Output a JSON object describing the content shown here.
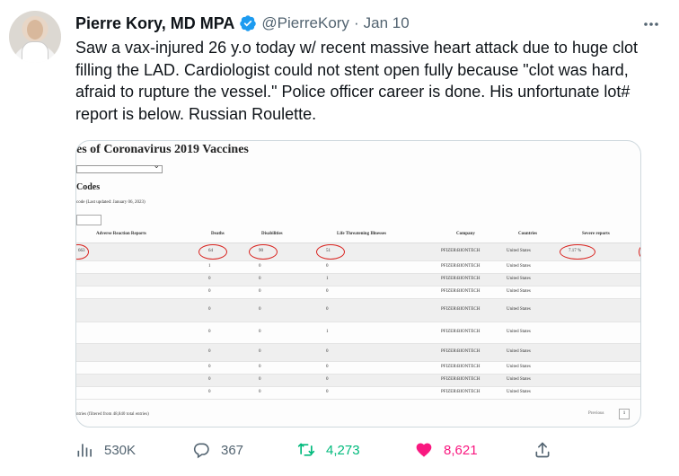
{
  "author": {
    "name": "Pierre Kory, MD MPA",
    "handle": "@PierreKory",
    "separator": "·",
    "date": "Jan 10"
  },
  "tweet": {
    "text": "Saw a vax-injured 26 y.o today w/ recent massive heart attack due to huge clot filling the LAD. Cardiologist could not stent open fully because \"clot was hard, afraid to rupture the vessel.\" Police officer career is done. His unfortunate lot# report is below. Russian Roulette."
  },
  "media": {
    "title": "es of Coronavirus 2019 Vaccines",
    "codes_heading": "Codes",
    "updated": "code (Last updated: January 06, 2023)",
    "columns": [
      "Adverse Reaction Reports",
      "Deaths",
      "Disabilities",
      "Life Threatening Illnesses",
      "Company",
      "Countries",
      "Severe reports"
    ],
    "rows": [
      {
        "reports": "663",
        "deaths": "64",
        "disabilities": "90",
        "life": "51",
        "company": "PFIZER\\BIONTECH",
        "country": "United States",
        "severe": "7.17 %"
      },
      {
        "reports": "",
        "deaths": "1",
        "disabilities": "0",
        "life": "0",
        "company": "PFIZER\\BIONTECH",
        "country": "United States",
        "severe": ""
      },
      {
        "reports": "",
        "deaths": "0",
        "disabilities": "0",
        "life": "1",
        "company": "PFIZER\\BIONTECH",
        "country": "United States",
        "severe": ""
      },
      {
        "reports": "",
        "deaths": "0",
        "disabilities": "0",
        "life": "0",
        "company": "PFIZER\\BIONTECH",
        "country": "United States",
        "severe": ""
      },
      {
        "reports": "",
        "deaths": "0",
        "disabilities": "0",
        "life": "0",
        "company": "PFIZER\\BIONTECH",
        "country": "United States",
        "severe": ""
      },
      {
        "reports": "",
        "deaths": "0",
        "disabilities": "0",
        "life": "1",
        "company": "PFIZER\\BIONTECH",
        "country": "United States",
        "severe": ""
      },
      {
        "reports": "",
        "deaths": "0",
        "disabilities": "0",
        "life": "0",
        "company": "PFIZER\\BIONTECH",
        "country": "United States",
        "severe": ""
      },
      {
        "reports": "",
        "deaths": "0",
        "disabilities": "0",
        "life": "0",
        "company": "PFIZER\\BIONTECH",
        "country": "United States",
        "severe": ""
      },
      {
        "reports": "",
        "deaths": "0",
        "disabilities": "0",
        "life": "0",
        "company": "PFIZER\\BIONTECH",
        "country": "United States",
        "severe": ""
      },
      {
        "reports": "",
        "deaths": "0",
        "disabilities": "0",
        "life": "0",
        "company": "PFIZER\\BIONTECH",
        "country": "United States",
        "severe": ""
      }
    ],
    "footer": "ntries (filtered from 48,840 total entries)",
    "previous": "Previous",
    "page": "1"
  },
  "actions": {
    "views": "530K",
    "replies": "367",
    "retweets": "4,273",
    "likes": "8,621"
  },
  "colors": {
    "verified": "#1d9bf0",
    "retweet": "#00ba7c",
    "like": "#f91880",
    "secondary_text": "#536471",
    "annotation_ring": "#d9231f"
  },
  "icons": [
    "verified-badge-icon",
    "more-icon",
    "views-icon",
    "reply-icon",
    "retweet-icon",
    "like-icon",
    "share-icon"
  ]
}
